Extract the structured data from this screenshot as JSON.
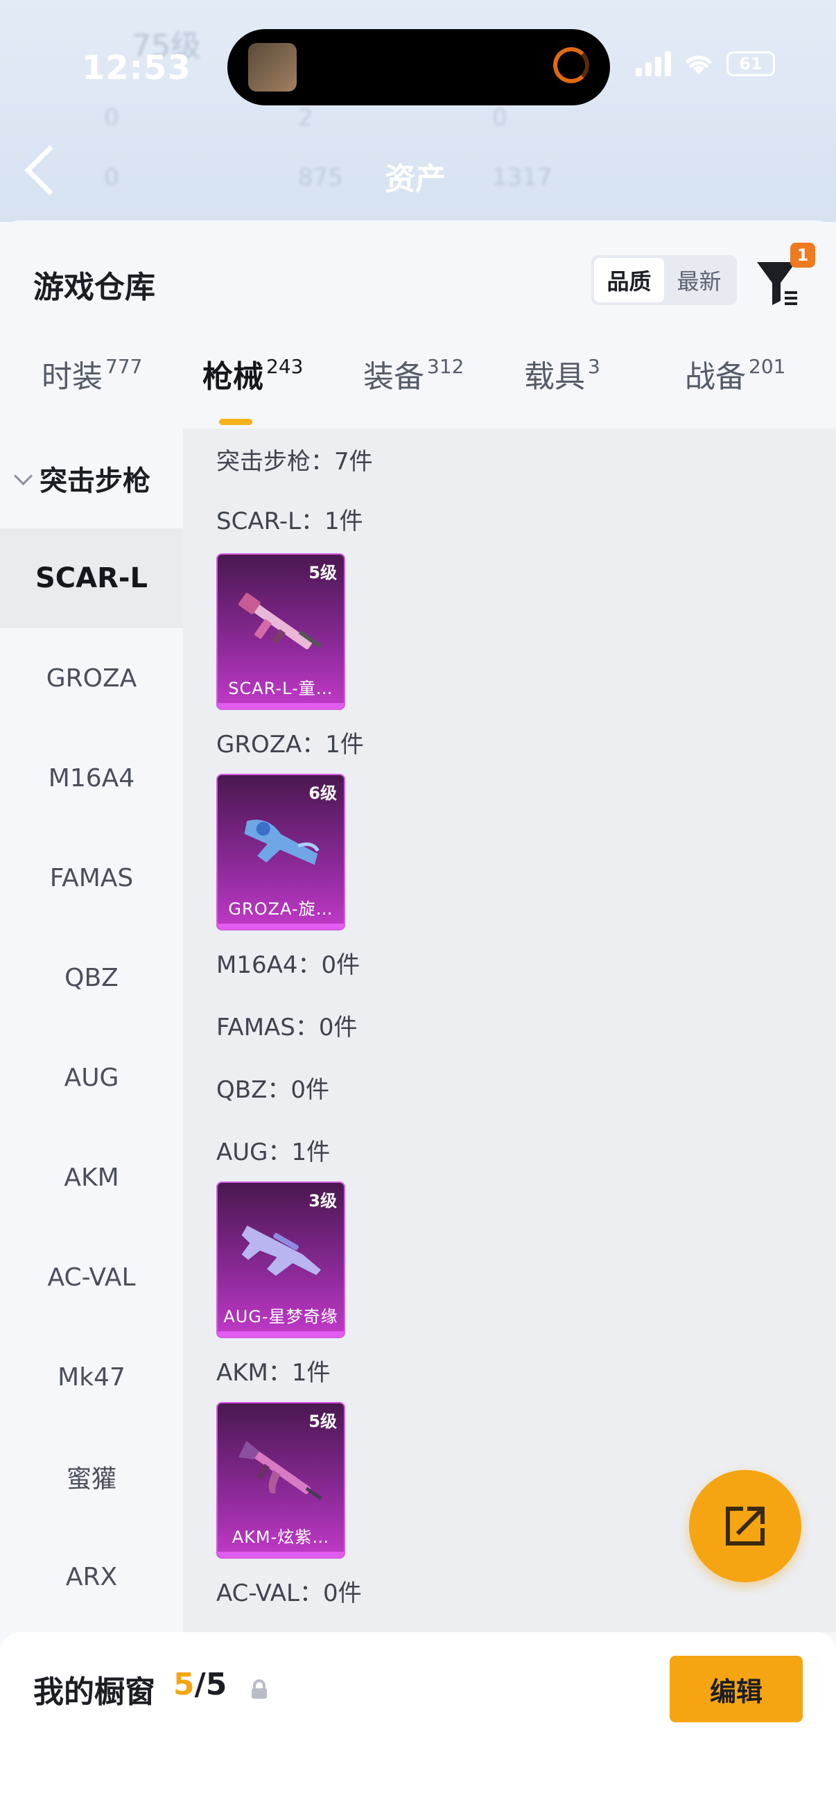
{
  "status_bar": {
    "time": "12:53",
    "battery": "61"
  },
  "header": {
    "title": "资产",
    "blurred_level": "75级",
    "blurred_stats": [
      "0",
      "2",
      "0",
      "0",
      "875",
      "1317"
    ]
  },
  "sheet": {
    "title": "游戏仓库",
    "sort": {
      "options": [
        "品质",
        "最新"
      ],
      "active": "品质"
    },
    "filter_badge": "1"
  },
  "tabs": [
    {
      "label": "时装",
      "count": "777"
    },
    {
      "label": "枪械",
      "count": "243",
      "active": true
    },
    {
      "label": "装备",
      "count": "312"
    },
    {
      "label": "载具",
      "count": "3"
    },
    {
      "label": "战备",
      "count": "201"
    }
  ],
  "sidenav": {
    "category": "突击步枪",
    "items": [
      "SCAR-L",
      "GROZA",
      "M16A4",
      "FAMAS",
      "QBZ",
      "AUG",
      "AKM",
      "AC-VAL",
      "Mk47",
      "蜜獾",
      "ARX"
    ],
    "active": "SCAR-L"
  },
  "content": {
    "summary": "突击步枪：7件",
    "groups": [
      {
        "label": "SCAR-L：1件",
        "card": {
          "level": "5级",
          "name": "SCAR-L-童…"
        }
      },
      {
        "label": "GROZA：1件",
        "card": {
          "level": "6级",
          "name": "GROZA-旋…"
        }
      },
      {
        "label": "M16A4：0件"
      },
      {
        "label": "FAMAS：0件"
      },
      {
        "label": "QBZ：0件"
      },
      {
        "label": "AUG：1件",
        "card": {
          "level": "3级",
          "name": "AUG-星梦奇缘"
        }
      },
      {
        "label": "AKM：1件",
        "card": {
          "level": "5级",
          "name": "AKM-炫紫…"
        }
      },
      {
        "label": "AC-VAL：0件"
      }
    ]
  },
  "bottom": {
    "title": "我的橱窗",
    "count_current": "5",
    "count_total": "/5",
    "edit_label": "编辑"
  },
  "colors": {
    "accent": "#f5a512",
    "tab_underline": "#f5b21b",
    "badge": "#f07a1f",
    "card_purple": "#8d2a9a"
  }
}
